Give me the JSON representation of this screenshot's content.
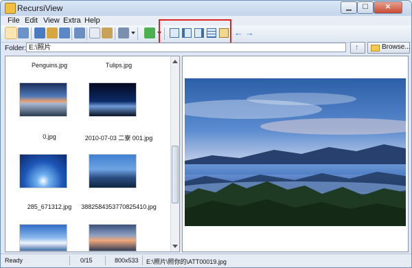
{
  "window": {
    "title": "RecursiView"
  },
  "menu": [
    "File",
    "Edit",
    "View",
    "Extra",
    "Help"
  ],
  "folder": {
    "label": "Folder:",
    "value": "E:\\照片",
    "browse_label": "Browse..."
  },
  "thumbnails": [
    {
      "caption": "Penguins.jpg"
    },
    {
      "caption": "Tulips.jpg"
    },
    {
      "caption": "0.jpg"
    },
    {
      "caption": "2010-07-03 二寮 001.jpg"
    },
    {
      "caption": "285_671312.jpg"
    },
    {
      "caption": "3882584353770825410.jpg"
    },
    {
      "caption": ""
    },
    {
      "caption": ""
    }
  ],
  "status": {
    "state": "Ready",
    "count": "0/15",
    "dimensions": "800x533",
    "path": "E:\\照片\\照你的\\ATT00019.jpg"
  },
  "toolbar_icons": [
    "thumbnails-view-icon",
    "multi-view-icon",
    "open-icon",
    "folder-open-icon",
    "slideshow-icon",
    "image-icon",
    "copy-icon",
    "paste-icon",
    "tools-icon",
    "filter-icon",
    "layout-1-icon",
    "layout-2-icon",
    "layout-3-icon",
    "layout-4-icon",
    "layout-5-icon",
    "back-icon",
    "forward-icon"
  ]
}
